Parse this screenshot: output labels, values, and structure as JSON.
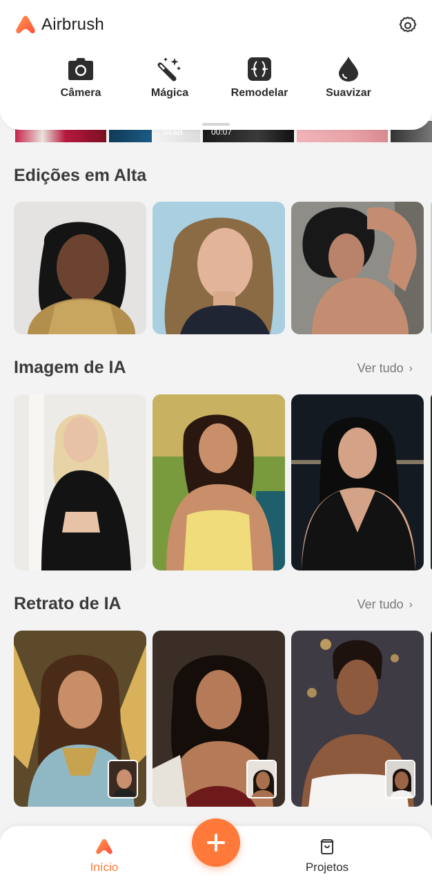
{
  "app": {
    "name": "Airbrush"
  },
  "tools": [
    {
      "label": "Câmera",
      "icon": "camera-icon"
    },
    {
      "label": "Mágica",
      "icon": "magic-wand-icon"
    },
    {
      "label": "Remodelar",
      "icon": "reshape-icon"
    },
    {
      "label": "Suavizar",
      "icon": "drop-icon"
    }
  ],
  "strip": {
    "scan_text": "Scan",
    "video_time": "00:07"
  },
  "sections": {
    "trending": {
      "title": "Edições em Alta"
    },
    "ai_image": {
      "title": "Imagem de IA",
      "see_all": "Ver tudo"
    },
    "ai_portrait": {
      "title": "Retrato de IA",
      "see_all": "Ver tudo"
    }
  },
  "nav": {
    "home": "Início",
    "projects": "Projetos",
    "add": "add-icon"
  },
  "colors": {
    "accent": "#ff7a3a",
    "background": "#f3f3f4"
  }
}
